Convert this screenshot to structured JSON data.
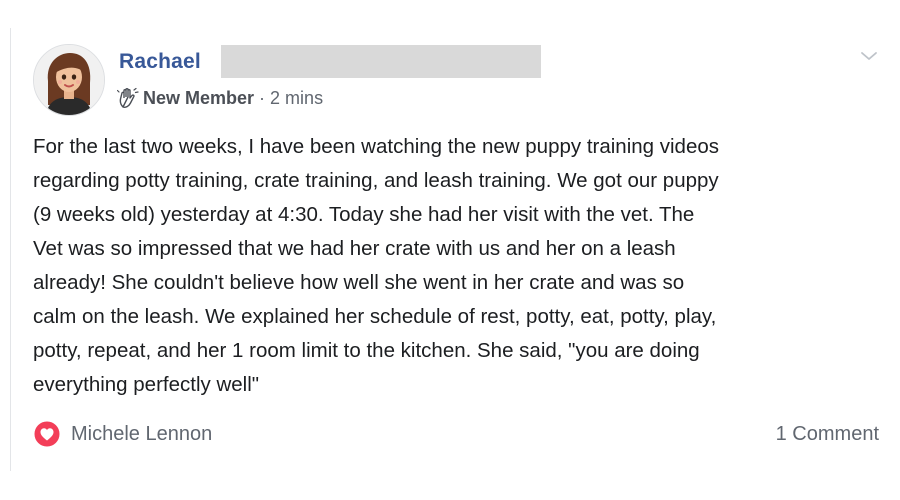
{
  "post": {
    "author_name": "Rachael",
    "author_badge": "New Member",
    "separator": "·",
    "timestamp": "2 mins",
    "body": "For the last two weeks, I have been watching the new puppy training videos\nregarding potty training, crate training, and leash training. We got our puppy\n(9 weeks old) yesterday at 4:30. Today she had her visit with the vet. The\nVet was so impressed that we had her crate with us and her on a leash\nalready! She couldn't believe how well she went in her crate and was so\ncalm on the leash. We explained her schedule of rest, potty, eat, potty, play,\npotty, repeat, and her 1 room limit to the kitchen. She said, \"you are doing\neverything perfectly well\"",
    "reactions": {
      "icon": "love-reaction-icon",
      "names": "Michele Lennon"
    },
    "comment_count": "1 Comment"
  },
  "colors": {
    "author": "#385898",
    "meta": "#616770",
    "body": "#1c1e21",
    "love": "#f33e58",
    "redaction": "#d9d9d9"
  }
}
